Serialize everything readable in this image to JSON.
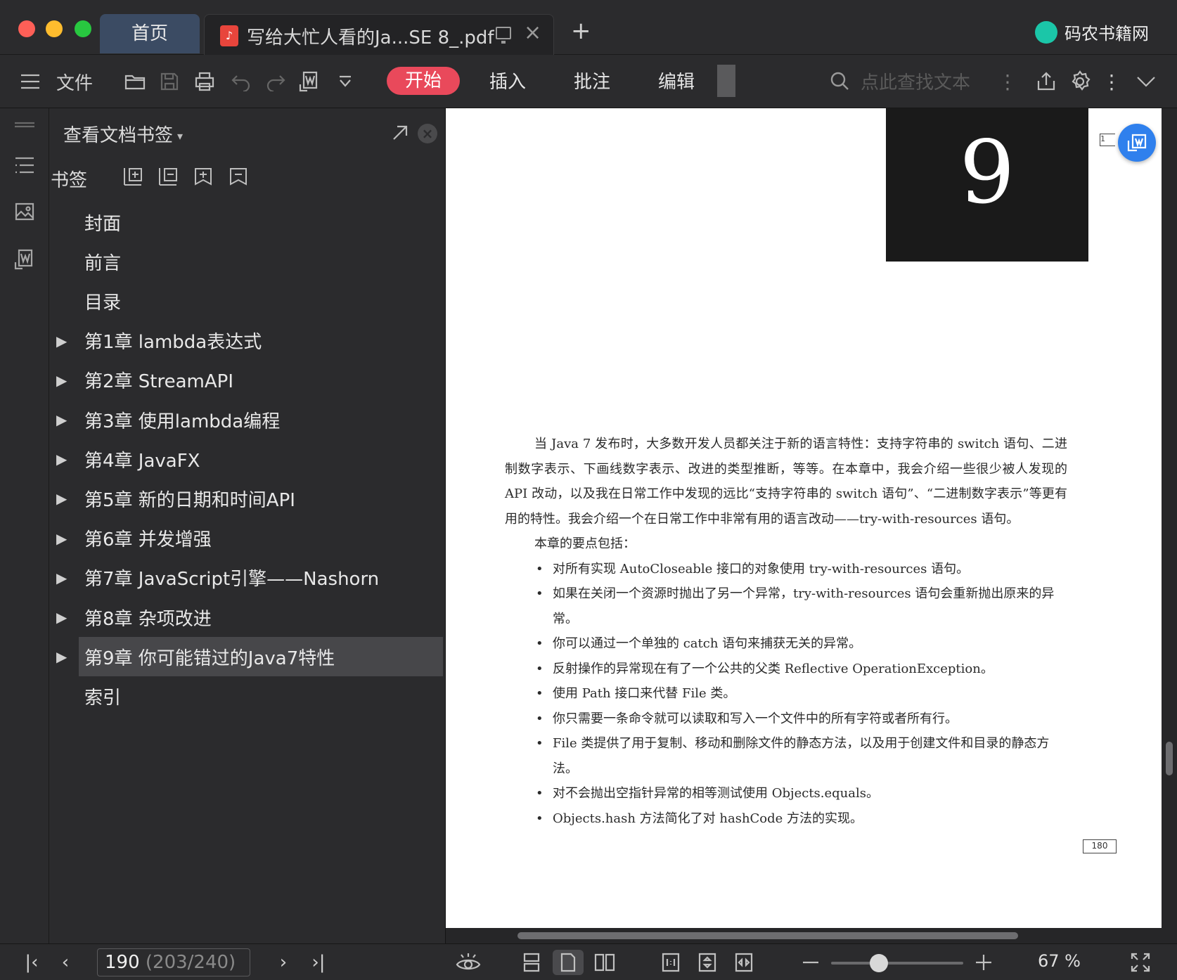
{
  "tabs": {
    "home_label": "首页",
    "doc_title": "写给大忙人看的Ja...SE 8_.pdf",
    "pdf_glyph": "♪",
    "close_glyph": "×",
    "add_glyph": "+"
  },
  "brand": {
    "name": "码农书籍网"
  },
  "toolbar": {
    "file_label": "文件",
    "ribbon_tabs": {
      "start": "开始",
      "insert": "插入",
      "annotate": "批注",
      "edit": "编辑"
    },
    "active_tab_color": "#e9495b",
    "search_placeholder": "点此查找文本",
    "kebab": "⋮"
  },
  "bookmark_panel": {
    "header": "查看文档书签",
    "caret": "▾",
    "close_glyph": "×",
    "sub_label": "书签",
    "items": [
      {
        "label": "封面",
        "expandable": false
      },
      {
        "label": "前言",
        "expandable": false
      },
      {
        "label": "目录",
        "expandable": false
      },
      {
        "label": "第1章 lambda表达式",
        "expandable": true
      },
      {
        "label": "第2章 StreamAPI",
        "expandable": true
      },
      {
        "label": "第3章 使用lambda编程",
        "expandable": true
      },
      {
        "label": "第4章 JavaFX",
        "expandable": true
      },
      {
        "label": "第5章 新的日期和时间API",
        "expandable": true
      },
      {
        "label": "第6章 并发增强",
        "expandable": true
      },
      {
        "label": "第7章 JavaScript引擎——Nashorn",
        "expandable": true
      },
      {
        "label": "第8章 杂项改进",
        "expandable": true
      },
      {
        "label": "第9章 你可能错过的Java7特性",
        "expandable": true,
        "selected": true
      },
      {
        "label": "索引",
        "expandable": false
      }
    ],
    "arrow_glyph": "▶"
  },
  "document": {
    "chapter_number": "9",
    "margin_mark_top": "1",
    "intro": "当 Java 7 发布时，大多数开发人员都关注于新的语言特性：支持字符串的 switch 语句、二进制数字表示、下画线数字表示、改进的类型推断，等等。在本章中，我会介绍一些很少被人发现的 API 改动，以及我在日常工作中发现的远比“支持字符串的 switch 语句”、“二进制数字表示”等更有用的特性。我会介绍一个在日常工作中非常有用的语言改动——try-with-resources 语句。",
    "key_points_label": "本章的要点包括：",
    "bullets": [
      "对所有实现 AutoCloseable 接口的对象使用 try-with-resources 语句。",
      "如果在关闭一个资源时抛出了另一个异常，try-with-resources 语句会重新抛出原来的异常。",
      "你可以通过一个单独的 catch 语句来捕获无关的异常。",
      "反射操作的异常现在有了一个公共的父类 Reflective OperationException。",
      "使用 Path 接口来代替 File 类。",
      "你只需要一条命令就可以读取和写入一个文件中的所有字符或者所有行。",
      "File 类提供了用于复制、移动和删除文件的静态方法，以及用于创建文件和目录的静态方法。",
      "对不会抛出空指针异常的相等测试使用 Objects.equals。",
      "Objects.hash 方法简化了对 hashCode 方法的实现。"
    ],
    "page_marker": "180"
  },
  "statusbar": {
    "current_page": "190",
    "page_total": "(203/240)",
    "zoom": "67 %",
    "zoom_fraction": 0.36,
    "first_glyph": "|‹",
    "prev_glyph": "‹",
    "next_glyph": "›",
    "last_glyph": "›|"
  },
  "scroll": {
    "vertical_fraction": 0.79,
    "horizontal_fraction": 0.1,
    "horizontal_thumb_fraction": 0.7
  }
}
